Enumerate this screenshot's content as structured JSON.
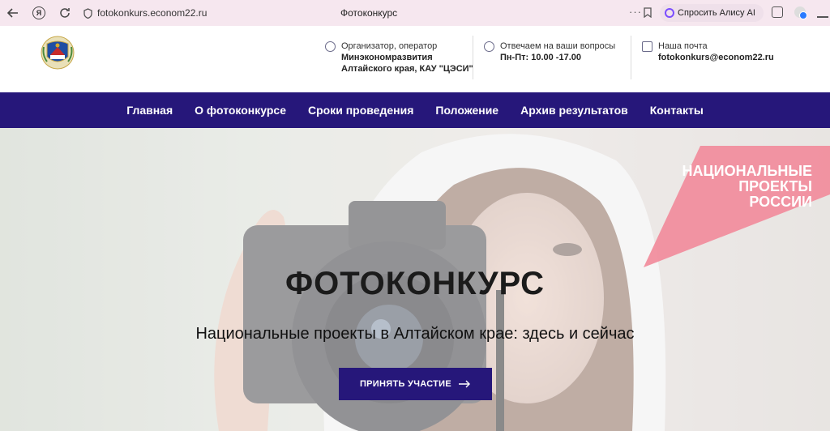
{
  "browser": {
    "url": "fotokonkurs.econom22.ru",
    "tab_title": "Фотоконкурс",
    "alice_button": "Спросить Алису AI",
    "ya_label": "Я"
  },
  "header": {
    "organizer": {
      "title": "Организатор, оператор",
      "line1": "Минэкономразвития",
      "line2": "Алтайского края, КАУ \"ЦЭСИ\""
    },
    "hours": {
      "title": "Отвечаем на ваши вопросы",
      "value": "Пн-Пт: 10.00 -17.00"
    },
    "mail": {
      "title": "Наша почта",
      "value": "fotokonkurs@econom22.ru"
    }
  },
  "nav": {
    "items": [
      "Главная",
      "О фотоконкурсе",
      "Сроки проведения",
      "Положение",
      "Архив результатов",
      "Контакты"
    ]
  },
  "hero": {
    "title": "ФОТОКОНКУРС",
    "subtitle": "Национальные проекты в Алтайском крае: здесь и сейчас",
    "cta_label": "ПРИНЯТЬ УЧАСТИЕ",
    "badge_line1": "НАЦИОНАЛЬНЫЕ",
    "badge_line2": "ПРОЕКТЫ",
    "badge_line3": "РОССИИ"
  },
  "colors": {
    "brand": "#26177a",
    "badge": "#f28a9a",
    "browser_bar": "#f6e7ef"
  }
}
